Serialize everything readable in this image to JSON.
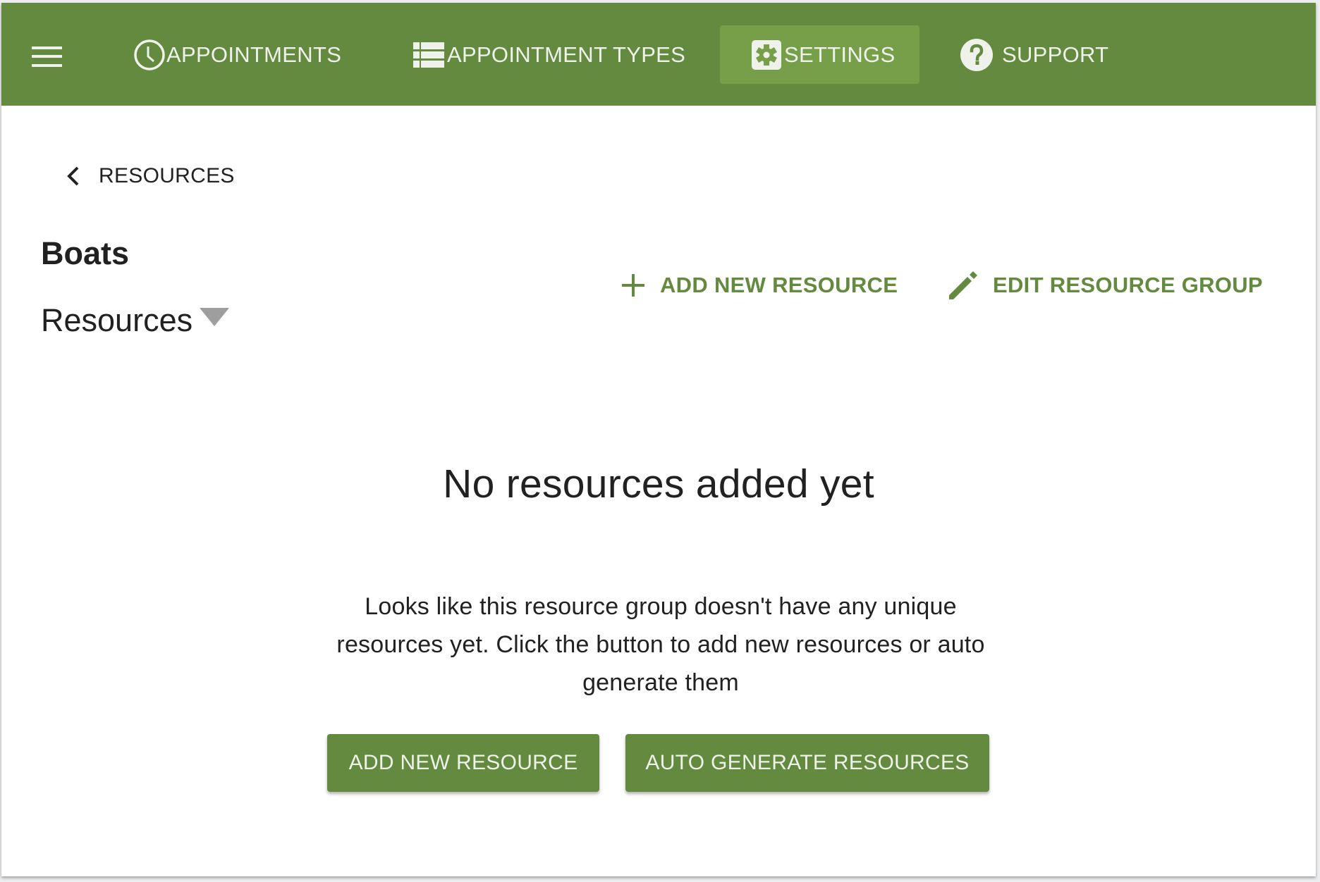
{
  "colors": {
    "brand": "#638a3f",
    "active_tab": "#779f4a",
    "header_text": "#eef2ea",
    "text": "#212121",
    "dropdown_arrow": "#9e9e9e"
  },
  "topbar": {
    "menu_icon": "hamburger-icon",
    "nav": [
      {
        "label": "APPOINTMENTS",
        "icon": "clock-icon",
        "active": false
      },
      {
        "label": "APPOINTMENT TYPES",
        "icon": "list-icon",
        "active": false
      },
      {
        "label": "SETTINGS",
        "icon": "gear-icon",
        "active": true
      },
      {
        "label": "SUPPORT",
        "icon": "help-circle-icon",
        "active": false
      }
    ]
  },
  "breadcrumb": {
    "back_label": "RESOURCES",
    "icon": "chevron-left-icon"
  },
  "group": {
    "title": "Boats",
    "section_dropdown": "Resources"
  },
  "actions": {
    "add_new_resource": "ADD NEW RESOURCE",
    "edit_resource_group": "EDIT RESOURCE GROUP"
  },
  "empty_state": {
    "title": "No resources added yet",
    "description": "Looks like this resource group doesn't have any unique resources yet. Click the button to add new resources or auto generate them",
    "add_button": "ADD NEW RESOURCE",
    "auto_generate_button": "AUTO GENERATE RESOURCES"
  }
}
